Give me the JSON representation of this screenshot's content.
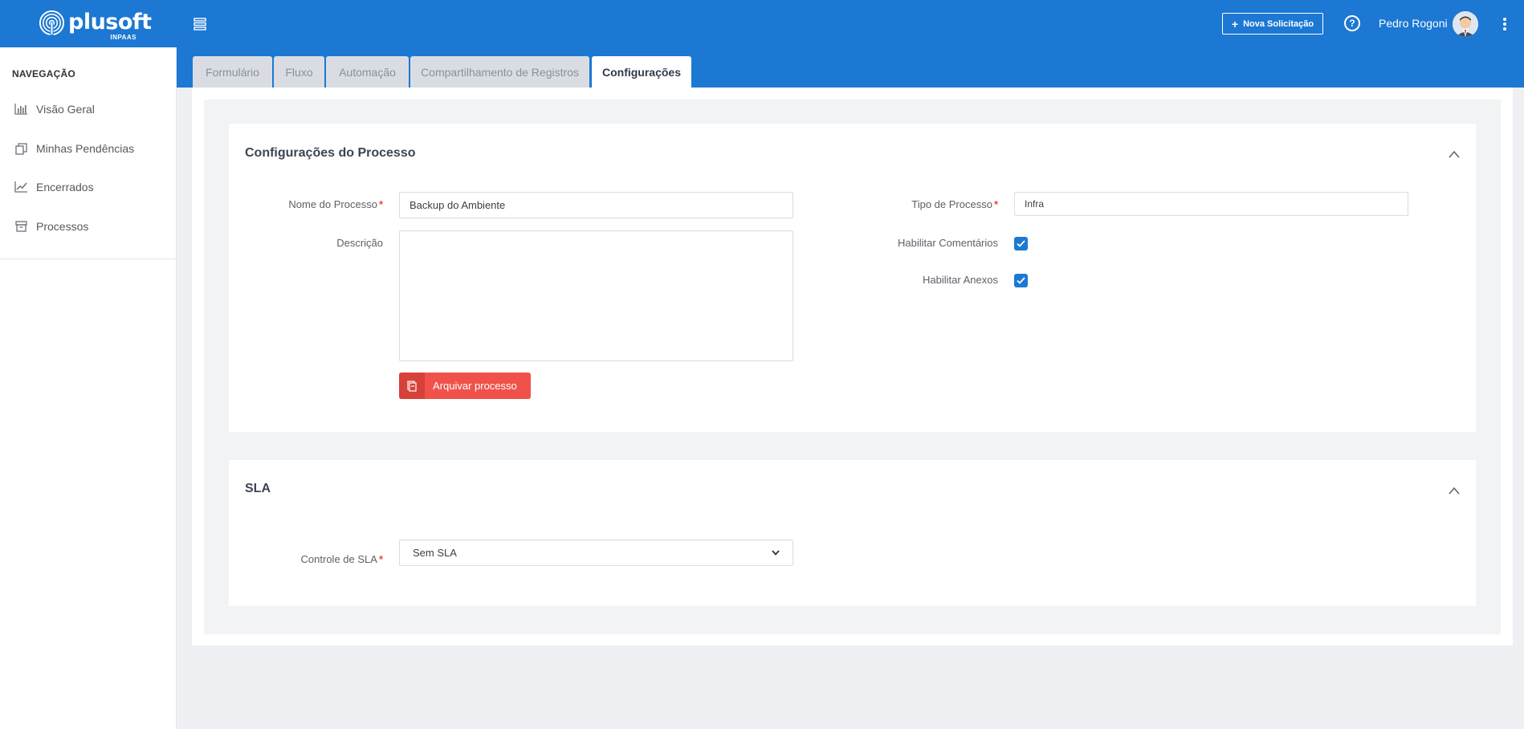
{
  "header": {
    "logo_text": "plusoft",
    "logo_sub": "INPAAS",
    "new_request_label": "Nova Solicitação",
    "user_name": "Pedro Rogoni"
  },
  "colors": {
    "primary": "#1c78d3",
    "danger": "#f0524b",
    "required": "#e74c3c"
  },
  "sidebar": {
    "title": "NAVEGAÇÃO",
    "items": [
      {
        "label": "Visão Geral",
        "icon": "bar-chart-icon"
      },
      {
        "label": "Minhas Pendências",
        "icon": "copy-icon"
      },
      {
        "label": "Encerrados",
        "icon": "line-chart-icon"
      },
      {
        "label": "Processos",
        "icon": "archive-icon"
      }
    ]
  },
  "tabs": [
    {
      "label": "Formulário",
      "active": false
    },
    {
      "label": "Fluxo",
      "active": false
    },
    {
      "label": "Automação",
      "active": false
    },
    {
      "label": "Compartilhamento de Registros",
      "active": false
    },
    {
      "label": "Configurações",
      "active": true
    }
  ],
  "process_config": {
    "title": "Configurações do Processo",
    "name_label": "Nome do Processo",
    "name_value": "Backup do Ambiente",
    "description_label": "Descrição",
    "description_value": "",
    "type_label": "Tipo de Processo",
    "type_value": "Infra",
    "comments_label": "Habilitar Comentários",
    "comments_checked": true,
    "attachments_label": "Habilitar Anexos",
    "attachments_checked": true,
    "archive_button_label": "Arquivar processo"
  },
  "sla": {
    "title": "SLA",
    "control_label": "Controle de SLA",
    "control_value": "Sem SLA"
  }
}
